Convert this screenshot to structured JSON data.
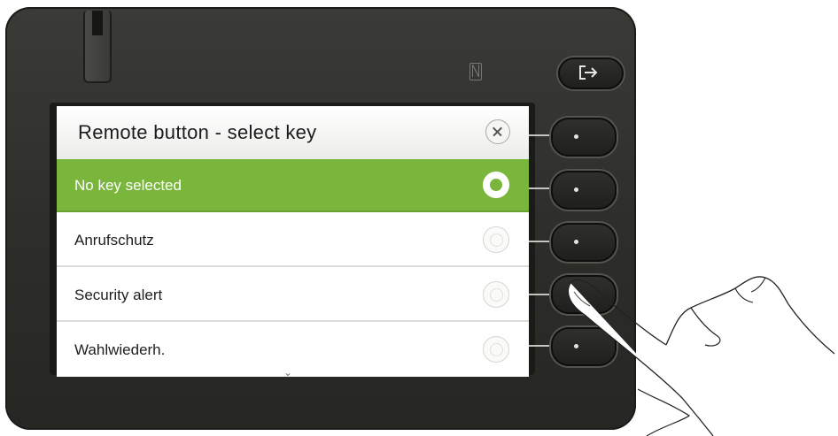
{
  "dialog": {
    "title": "Remote button - select key",
    "close_icon": "close-icon",
    "items": [
      {
        "label": "No key selected",
        "selected": true
      },
      {
        "label": "Anrufschutz",
        "selected": false
      },
      {
        "label": "Security alert",
        "selected": false
      },
      {
        "label": "Wahlwiederh.",
        "selected": false
      }
    ],
    "more_indicator": "chevron-down-icon"
  },
  "device": {
    "logout_icon": "logout-icon",
    "nfc_icon": "nfc-icon",
    "side_keys": 5
  },
  "colors": {
    "selected_row": "#7ab53c",
    "housing": "#2d2d2a",
    "screen_bg": "#ffffff"
  }
}
